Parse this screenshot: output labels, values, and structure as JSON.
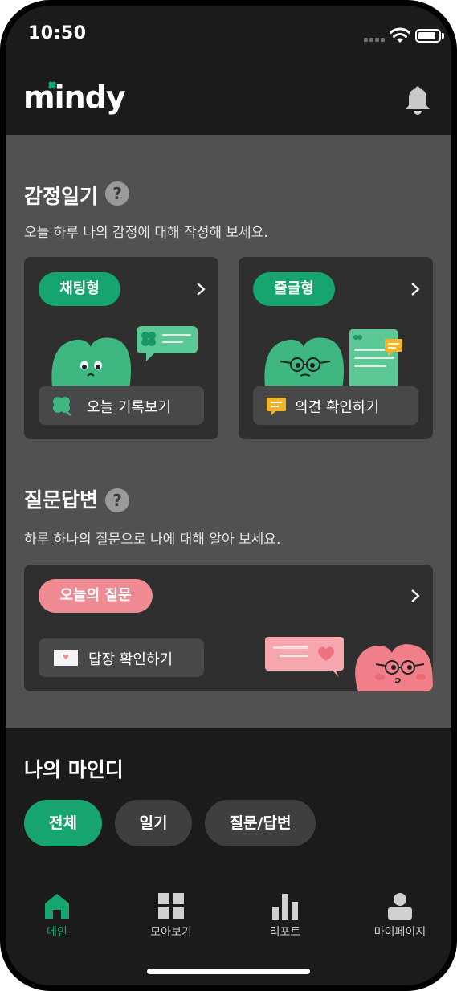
{
  "status_bar": {
    "time": "10:50"
  },
  "header": {
    "logo": "mindy",
    "bell_icon": "bell-icon"
  },
  "emotion_diary": {
    "title": "감정일기",
    "help": "?",
    "description": "오늘 하루 나의 감정에 대해 작성해 보세요.",
    "cards": [
      {
        "tag": "채팅형",
        "button_label": "오늘 기록보기",
        "button_icon": "clover-icon"
      },
      {
        "tag": "줄글형",
        "button_label": "의견 확인하기",
        "button_icon": "speech-bubble-icon"
      }
    ]
  },
  "qa": {
    "title": "질문답변",
    "help": "?",
    "description": "하루 하나의 질문으로 나에 대해 알아 보세요.",
    "card": {
      "tag": "오늘의 질문",
      "button_label": "답장 확인하기",
      "button_icon": "envelope-icon"
    }
  },
  "my_mindy": {
    "title": "나의 마인디",
    "filters": [
      {
        "label": "전체",
        "active": true
      },
      {
        "label": "일기",
        "active": false
      },
      {
        "label": "질문/답변",
        "active": false
      }
    ]
  },
  "tab_bar": [
    {
      "label": "메인",
      "icon": "home-icon",
      "active": true
    },
    {
      "label": "모아보기",
      "icon": "grid-icon",
      "active": false
    },
    {
      "label": "리포트",
      "icon": "bar-chart-icon",
      "active": false
    },
    {
      "label": "마이페이지",
      "icon": "profile-icon",
      "active": false
    }
  ],
  "colors": {
    "accent": "#16a56e",
    "pink": "#f08a93",
    "surface": "#2f2f2f",
    "background": "#515151"
  }
}
